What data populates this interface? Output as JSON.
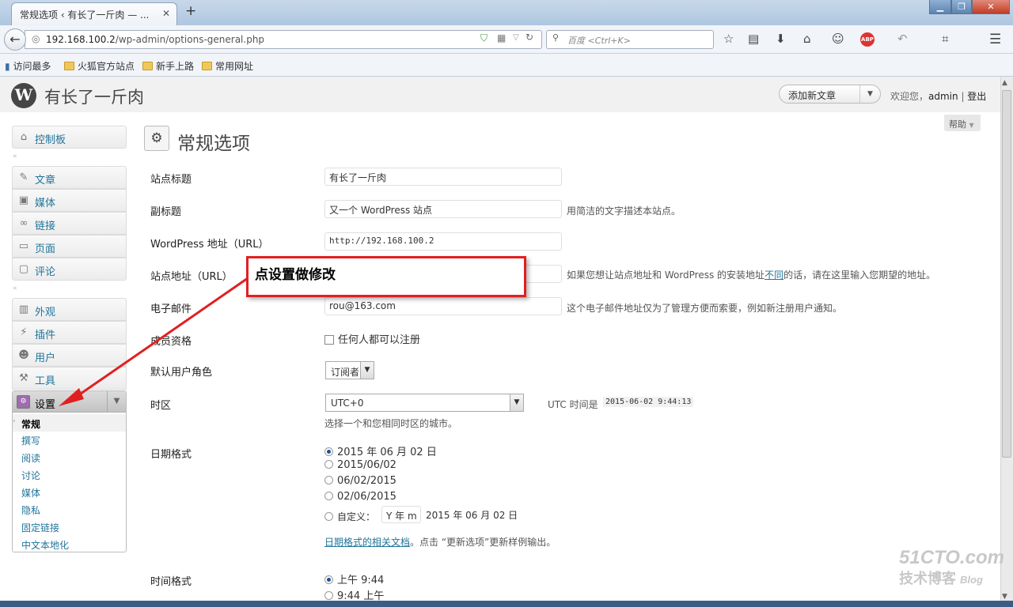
{
  "browser": {
    "tab_title": "常规选项 ‹ 有长了一斤肉 — ...",
    "tab_close": "✕",
    "new_tab": "+",
    "url_host": "192.168.100.2",
    "url_path": "/wp-admin/options-general.php",
    "search_placeholder": "百度 <Ctrl+K>",
    "bookmarks": [
      "访问最多",
      "火狐官方站点",
      "新手上路",
      "常用网址"
    ],
    "win_controls": [
      "▁",
      "❐",
      "✕"
    ]
  },
  "wp": {
    "site_name": "有长了一斤肉",
    "add_new": "添加新文章",
    "howdy": "欢迎您，",
    "user": "admin",
    "sep": " | ",
    "logout": "登出",
    "help": "帮助"
  },
  "sidebar": {
    "dashboard": "控制板",
    "posts": "文章",
    "media": "媒体",
    "links": "链接",
    "pages": "页面",
    "comments": "评论",
    "appearance": "外观",
    "plugins": "插件",
    "users": "用户",
    "tools": "工具",
    "settings": "设置",
    "settings_sub": [
      "常规",
      "撰写",
      "阅读",
      "讨论",
      "媒体",
      "隐私",
      "固定链接",
      "中文本地化"
    ]
  },
  "page": {
    "title": "常规选项",
    "site_title_label": "站点标题",
    "site_title_value": "有长了一斤肉",
    "tagline_label": "副标题",
    "tagline_value": "又一个 WordPress 站点",
    "tagline_desc": "用简洁的文字描述本站点。",
    "wpurl_label": "WordPress 地址（URL）",
    "wpurl_value": "http://192.168.100.2",
    "siteurl_label": "站点地址（URL）",
    "siteurl_desc_a": "如果您想让站点地址和 WordPress 的安装地址",
    "siteurl_desc_link": "不同",
    "siteurl_desc_b": "的话，请在这里输入您期望的地址。",
    "email_label": "电子邮件",
    "email_value": "rou@163.com",
    "email_desc": "这个电子邮件地址仅为了管理方便而索要，例如新注册用户通知。",
    "membership_label": "成员资格",
    "membership_option": "任何人都可以注册",
    "role_label": "默认用户角色",
    "role_value": "订阅者",
    "timezone_label": "时区",
    "timezone_value": "UTC+0",
    "utc_label": "UTC 时间是",
    "utc_value": "2015-06-02 9:44:13",
    "timezone_desc": "选择一个和您相同时区的城市。",
    "date_format_label": "日期格式",
    "date_options": [
      "2015 年 06 月 02 日",
      "2015/06/02",
      "06/02/2015",
      "02/06/2015"
    ],
    "date_custom_label": "自定义：",
    "date_custom_value": "Y 年 m",
    "date_custom_preview": "2015 年 06 月 02 日",
    "date_doc_link": "日期格式的相关文档",
    "date_doc_rest": "。点击 “更新选项”更新样例输出。",
    "time_format_label": "时间格式",
    "time_options": [
      "上午 9:44",
      "9:44 上午"
    ]
  },
  "annotation": {
    "callout": "点设置做修改"
  },
  "watermark": {
    "line1": "51CTO.com",
    "line2": "技术博客",
    "line3": "Blog"
  }
}
